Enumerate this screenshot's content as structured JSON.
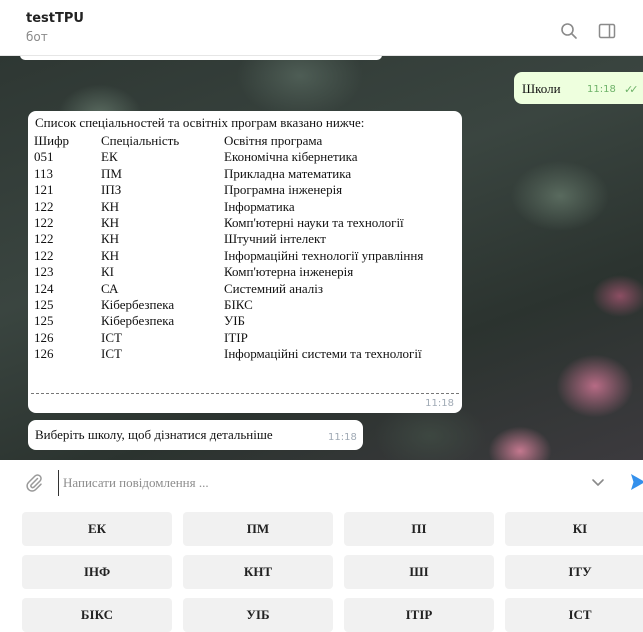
{
  "header": {
    "title": "testTPU",
    "subtitle": "бот",
    "icons": [
      "search-icon",
      "sidebar-toggle-icon"
    ]
  },
  "messages": {
    "outgoing": {
      "text": "Школи",
      "time": "11:18",
      "status": "read"
    },
    "list": {
      "intro": "Список спеціальностей та освітніх програм вказано нижче:",
      "header": [
        "Шифр",
        "Спеціальність",
        "Освітня програма"
      ],
      "rows": [
        [
          "051",
          "ЕК",
          "Економічна кібернетика"
        ],
        [
          "113",
          "ПМ",
          "Прикладна математика"
        ],
        [
          "121",
          "ІПЗ",
          "Програмна інженерія"
        ],
        [
          "122",
          "КН",
          "Інформатика"
        ],
        [
          "122",
          "КН",
          "Комп'ютерні науки та технології"
        ],
        [
          "122",
          "КН",
          "Штучний інтелект"
        ],
        [
          "122",
          "КН",
          "Інформаційні технології управління"
        ],
        [
          "123",
          "КІ",
          "Комп'ютерна інженерія"
        ],
        [
          "124",
          "СА",
          "Системний аналіз"
        ],
        [
          "125",
          "Кібербезпека",
          "БІКС"
        ],
        [
          "125",
          "Кібербезпека",
          "УІБ"
        ],
        [
          "126",
          "ІСТ",
          "ІТІР"
        ],
        [
          "126",
          "ІСТ",
          "Інформаційні системи та технології"
        ]
      ],
      "time": "11:18"
    },
    "prompt": {
      "text": "Виберіть школу, щоб дізнатися детальніше",
      "time": "11:18"
    }
  },
  "composer": {
    "placeholder": "Написати повідомлення ..."
  },
  "keyboard": {
    "buttons": [
      "ЕК",
      "ПМ",
      "ПІ",
      "КІ",
      "ІНФ",
      "КНТ",
      "ШІ",
      "ІТУ",
      "БІКС",
      "УІБ",
      "ІТІР",
      "ІСТ"
    ]
  },
  "colors": {
    "outgoing_bubble": "#eeffde",
    "accent": "#3390ec",
    "check": "#6fb36a",
    "keyboard_button": "#f1f1f1"
  }
}
